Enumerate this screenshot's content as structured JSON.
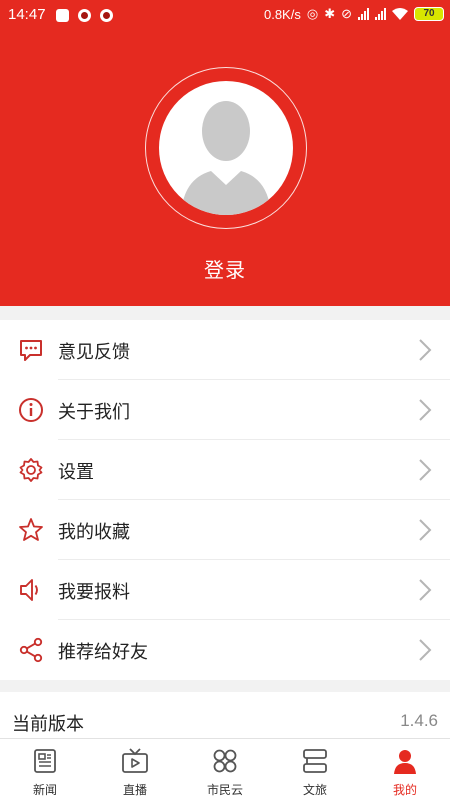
{
  "status_bar": {
    "time": "14:47",
    "network_speed": "0.8K/s",
    "battery": "70"
  },
  "profile": {
    "login_label": "登录"
  },
  "menu": {
    "items": [
      {
        "label": "意见反馈",
        "icon": "feedback-chat-icon"
      },
      {
        "label": "关于我们",
        "icon": "info-icon"
      },
      {
        "label": "设置",
        "icon": "gear-icon"
      },
      {
        "label": "我的收藏",
        "icon": "star-icon"
      },
      {
        "label": "我要报料",
        "icon": "speaker-icon"
      },
      {
        "label": "推荐给好友",
        "icon": "share-icon"
      }
    ]
  },
  "version": {
    "label": "当前版本",
    "value": "1.4.6"
  },
  "tabbar": {
    "tabs": [
      {
        "label": "新闻",
        "icon": "news-icon"
      },
      {
        "label": "直播",
        "icon": "tv-icon"
      },
      {
        "label": "市民云",
        "icon": "cloud-grid-icon"
      },
      {
        "label": "文旅",
        "icon": "travel-icon"
      },
      {
        "label": "我的",
        "icon": "person-icon",
        "active": true
      }
    ]
  },
  "colors": {
    "brand_red": "#e52a20",
    "icon_red": "#c9302c",
    "chevron_gray": "#b5b5b5"
  }
}
